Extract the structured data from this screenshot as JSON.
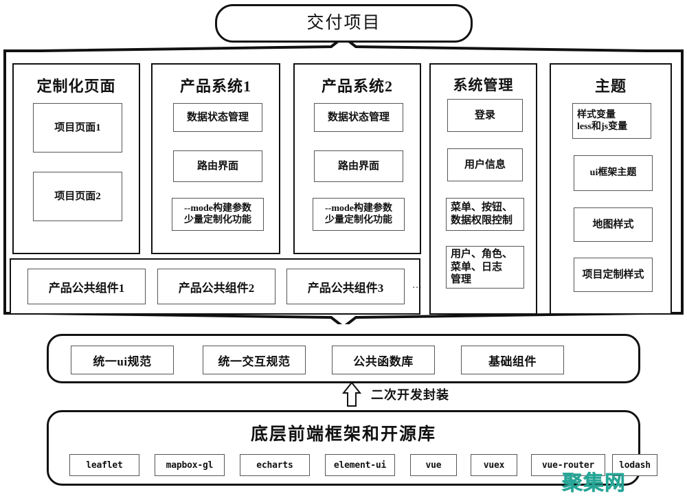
{
  "diagram": {
    "title": "交付项目",
    "delivery": {
      "label": "交付项目"
    },
    "columns": [
      {
        "id": "custom-pages",
        "title": "定制化页面",
        "cells": [
          {
            "label": "项目页面1",
            "style": "cn"
          },
          {
            "label": "项目页面2",
            "style": "cn"
          }
        ]
      },
      {
        "id": "product-system-1",
        "title": "产品系统1",
        "cells": [
          {
            "label": "数据状态管理",
            "style": "cn"
          },
          {
            "label": "路由界面",
            "style": "cn"
          },
          {
            "label": "--mode构建参数\n少量定制化功能",
            "style": "mixed"
          }
        ]
      },
      {
        "id": "product-system-2",
        "title": "产品系统2",
        "cells": [
          {
            "label": "数据状态管理",
            "style": "cn"
          },
          {
            "label": "路由界面",
            "style": "cn"
          },
          {
            "label": "--mode构建参数\n少量定制化功能",
            "style": "mixed"
          }
        ]
      },
      {
        "id": "system-management",
        "title": "系统管理",
        "cells": [
          {
            "label": "登录",
            "style": "cn"
          },
          {
            "label": "用户信息",
            "style": "cn"
          },
          {
            "label": "菜单、按钮、\n数据权限控制",
            "style": "cn-left"
          },
          {
            "label": "用户、角色、\n菜单、日志\n管理",
            "style": "cn-left"
          }
        ]
      },
      {
        "id": "theme",
        "title": "主题",
        "cells": [
          {
            "label": "样式变量\nless和js变量",
            "style": "mixed-left"
          },
          {
            "label": "ui框架主题",
            "style": "mixed"
          },
          {
            "label": "地图样式",
            "style": "cn"
          },
          {
            "label": "项目定制样式",
            "style": "cn"
          }
        ]
      }
    ],
    "shared_components": {
      "items": [
        "产品公共组件1",
        "产品公共组件2",
        "产品公共组件3"
      ],
      "ellipsis": "…"
    },
    "middle_layer": {
      "items": [
        "统一ui规范",
        "统一交互规范",
        "公共函数库",
        "基础组件"
      ]
    },
    "dev_arrow": {
      "label": "二次开发封装",
      "icon": "arrow-up-icon"
    },
    "bottom_layer": {
      "title": "底层前端框架和开源库",
      "libraries": [
        "leaflet",
        "mapbox-gl",
        "echarts",
        "element-ui",
        "vue",
        "vuex",
        "vue-router",
        "lodash"
      ]
    },
    "watermark": {
      "text": "聚集网",
      "color": "#27a596"
    },
    "colors": {
      "line": "#111111",
      "cell_border": "#555555",
      "background": "#ffffff",
      "watermark": "#27a596"
    }
  }
}
